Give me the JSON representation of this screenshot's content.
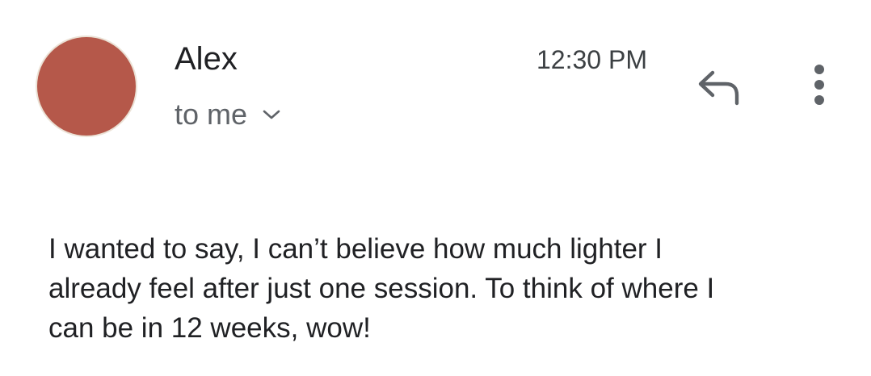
{
  "colors": {
    "avatar": "#b5584a",
    "text_primary": "#202124",
    "text_secondary": "#5f6368",
    "icon": "#5f6368"
  },
  "message": {
    "sender": "Alex",
    "recipient": "to me",
    "time": "12:30 PM",
    "body": "I wanted to say, I can’t believe how much lighter I\nalready feel after just one session. To think of where I\ncan be in 12 weeks, wow!"
  },
  "icons": {
    "expand_details": "chevron-down-icon",
    "reply": "reply-icon",
    "more": "more-vert-icon"
  }
}
